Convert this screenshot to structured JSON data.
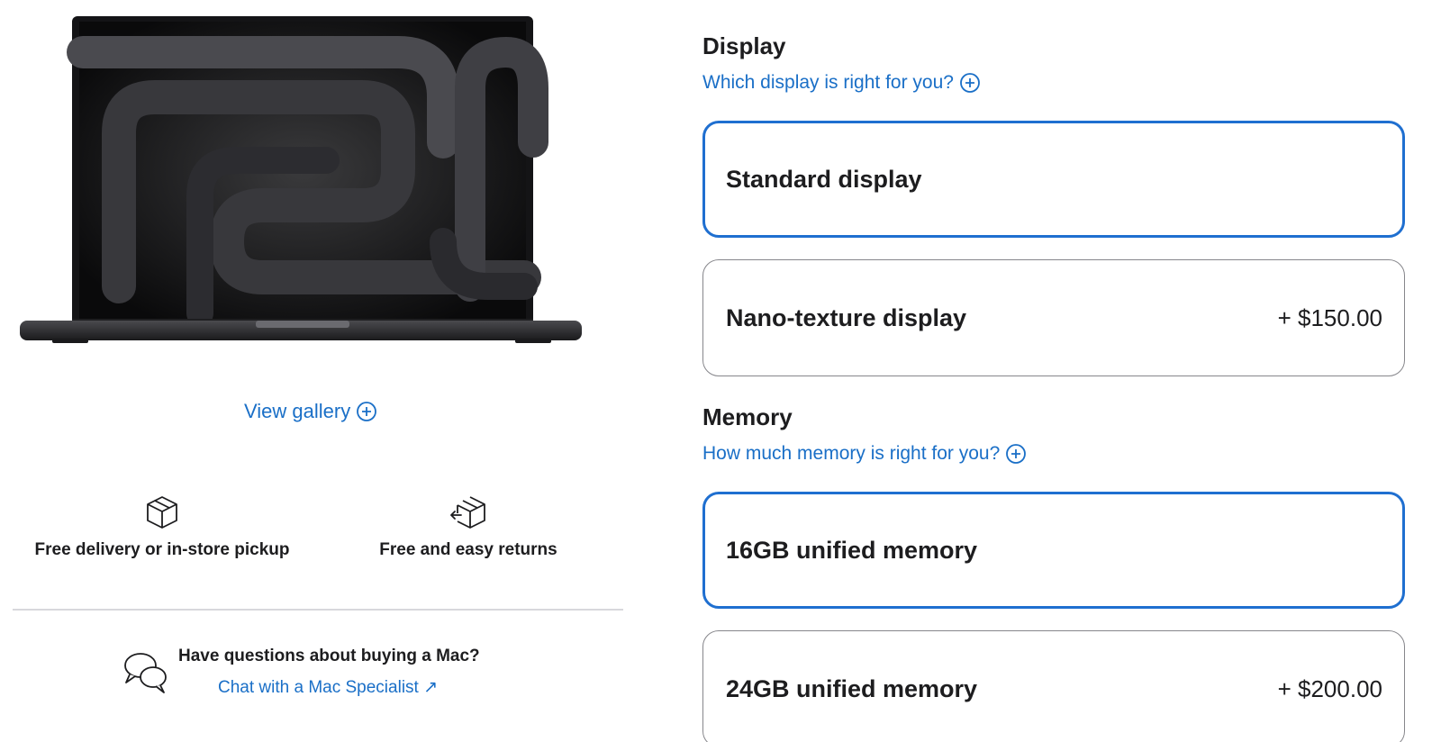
{
  "gallery": {
    "link_label": "View gallery",
    "link_icon": "plus-circle-icon"
  },
  "perks": [
    {
      "label": "Free delivery or in-store pickup",
      "icon": "box-icon"
    },
    {
      "label": "Free and easy returns",
      "icon": "box-return-icon"
    }
  ],
  "help": {
    "question": "Have questions about buying a Mac?",
    "chat_link": "Chat with a Mac Specialist ↗",
    "icon": "chat-bubbles-icon"
  },
  "display": {
    "title": "Display",
    "help_link": "Which display is right for you?",
    "options": [
      {
        "label": "Standard display",
        "price": "",
        "selected": true
      },
      {
        "label": "Nano-texture display",
        "price": "+ $150.00",
        "selected": false
      }
    ]
  },
  "memory": {
    "title": "Memory",
    "help_link": "How much memory is right for you?",
    "options": [
      {
        "label": "16GB unified memory",
        "price": "",
        "selected": true
      },
      {
        "label": "24GB unified memory",
        "price": "+ $200.00",
        "selected": false
      }
    ]
  },
  "colors": {
    "accent": "#1a6fc7",
    "selected_border": "#1f6fd0",
    "text": "#1d1d1f",
    "border": "#86868b"
  }
}
